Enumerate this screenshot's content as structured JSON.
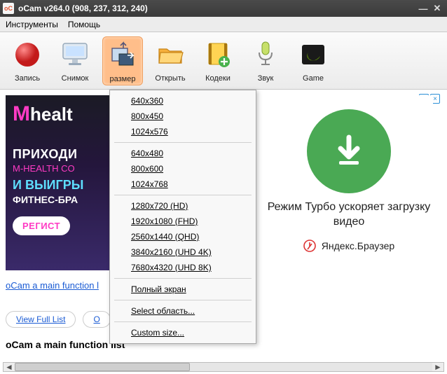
{
  "window": {
    "title": "oCam v264.0 (908, 237, 312, 240)"
  },
  "menubar": {
    "tools": "Инструменты",
    "help": "Помощь"
  },
  "toolbar": {
    "record": "Запись",
    "snapshot": "Снимок",
    "size": "размер",
    "open": "Открыть",
    "codecs": "Кодеки",
    "sound": "Звук",
    "game": "Game"
  },
  "dropdown": {
    "items": [
      "640x360",
      "800x450",
      "1024x576",
      "-",
      "640x480",
      "800x600",
      "1024x768",
      "-",
      "1280x720 (HD)",
      "1920x1080 (FHD)",
      "2560x1440 (QHD)",
      "3840x2160 (UHD 4K)",
      "7680x4320 (UHD 8K)",
      "-",
      "Полный экран",
      "-",
      "Select область...",
      "-",
      "Custom size..."
    ]
  },
  "ad_left": {
    "logo_m": "M",
    "logo_rest": "healt",
    "line1": "ПРИХОДИ",
    "line2": "M-HEALTH CO",
    "line3": "И ВЫИГРЫ",
    "line4": "ФИТНЕС-БРА",
    "button": "РЕГИСТ"
  },
  "ad_right": {
    "headline": "Режим Турбо ускоряет загрузку видео",
    "brand": "Яндекс.Браузер"
  },
  "links": {
    "line": "oCam a main function l",
    "view_full": "View Full List",
    "other": "O"
  },
  "heading": "oCam a main function list",
  "ad_badge": {
    "info": "i",
    "close": "×"
  }
}
